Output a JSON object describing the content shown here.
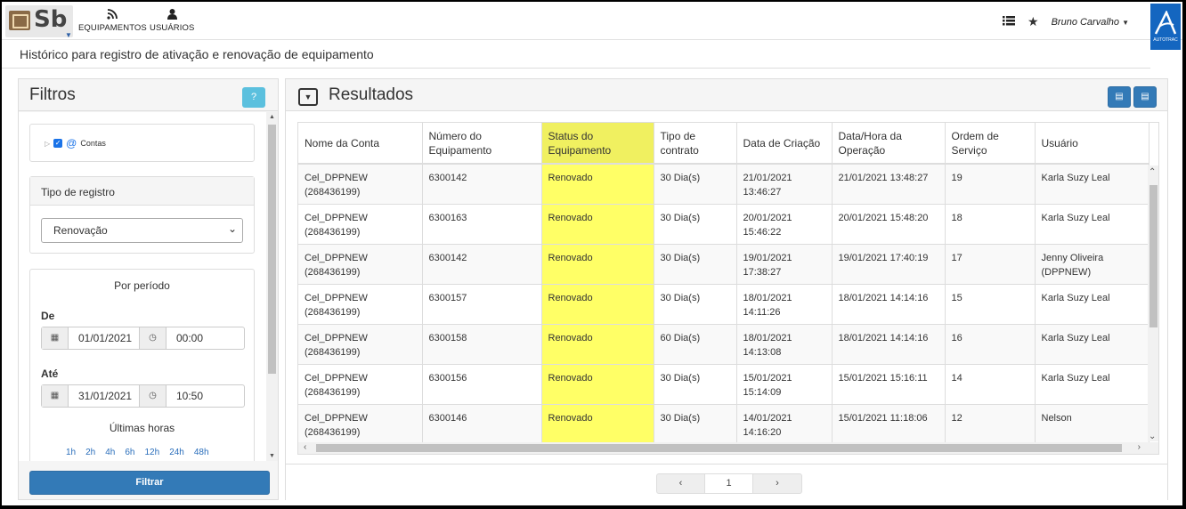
{
  "app": {
    "logo_text": "Sb",
    "brand_text": "AUTOTRAC"
  },
  "nav": {
    "items": [
      {
        "label": "EQUIPAMENTOS",
        "icon": "rss-icon"
      },
      {
        "label": "USUÁRIOS",
        "icon": "user-icon"
      }
    ]
  },
  "user": {
    "name": "Bruno Carvalho"
  },
  "page": {
    "subtitle": "Histórico para registro de ativação e renovação de equipamento"
  },
  "filters": {
    "title": "Filtros",
    "help_icon": "?",
    "tree_label": "Contas",
    "tipo_title": "Tipo de registro",
    "tipo_value": "Renovação",
    "period_title": "Por período",
    "de_label": "De",
    "de_date": "01/01/2021",
    "de_time": "00:00",
    "ate_label": "Até",
    "ate_date": "31/01/2021",
    "ate_time": "10:50",
    "ultimas_label": "Últimas horas",
    "hours": [
      "1h",
      "2h",
      "4h",
      "6h",
      "12h",
      "24h",
      "48h"
    ],
    "button": "Filtrar"
  },
  "results": {
    "title": "Resultados",
    "columns": [
      "Nome da Conta",
      "Número do Equipamento",
      "Status do Equipamento",
      "Tipo de contrato",
      "Data de Criação",
      "Data/Hora da Operação",
      "Ordem de Serviço",
      "Usuário"
    ],
    "rows": [
      [
        "Cel_DPPNEW (268436199)",
        "6300142",
        "Renovado",
        "30 Dia(s)",
        "21/01/2021 13:46:27",
        "21/01/2021 13:48:27",
        "19",
        "Karla Suzy Leal"
      ],
      [
        "Cel_DPPNEW (268436199)",
        "6300163",
        "Renovado",
        "30 Dia(s)",
        "20/01/2021 15:46:22",
        "20/01/2021 15:48:20",
        "18",
        "Karla Suzy Leal"
      ],
      [
        "Cel_DPPNEW (268436199)",
        "6300142",
        "Renovado",
        "30 Dia(s)",
        "19/01/2021 17:38:27",
        "19/01/2021 17:40:19",
        "17",
        "Jenny Oliveira (DPPNEW)"
      ],
      [
        "Cel_DPPNEW (268436199)",
        "6300157",
        "Renovado",
        "30 Dia(s)",
        "18/01/2021 14:11:26",
        "18/01/2021 14:14:16",
        "15",
        "Karla Suzy Leal"
      ],
      [
        "Cel_DPPNEW (268436199)",
        "6300158",
        "Renovado",
        "60 Dia(s)",
        "18/01/2021 14:13:08",
        "18/01/2021 14:14:16",
        "16",
        "Karla Suzy Leal"
      ],
      [
        "Cel_DPPNEW (268436199)",
        "6300156",
        "Renovado",
        "30 Dia(s)",
        "15/01/2021 15:14:09",
        "15/01/2021 15:16:11",
        "14",
        "Karla Suzy Leal"
      ],
      [
        "Cel_DPPNEW (268436199)",
        "6300146",
        "Renovado",
        "30 Dia(s)",
        "14/01/2021 14:16:20",
        "15/01/2021 11:18:06",
        "12",
        "Nelson"
      ]
    ],
    "page": "1",
    "prev": "‹",
    "next": "›"
  },
  "colors": {
    "accent": "#337ab7",
    "highlight": "#ffff66",
    "help": "#5bc0de"
  }
}
